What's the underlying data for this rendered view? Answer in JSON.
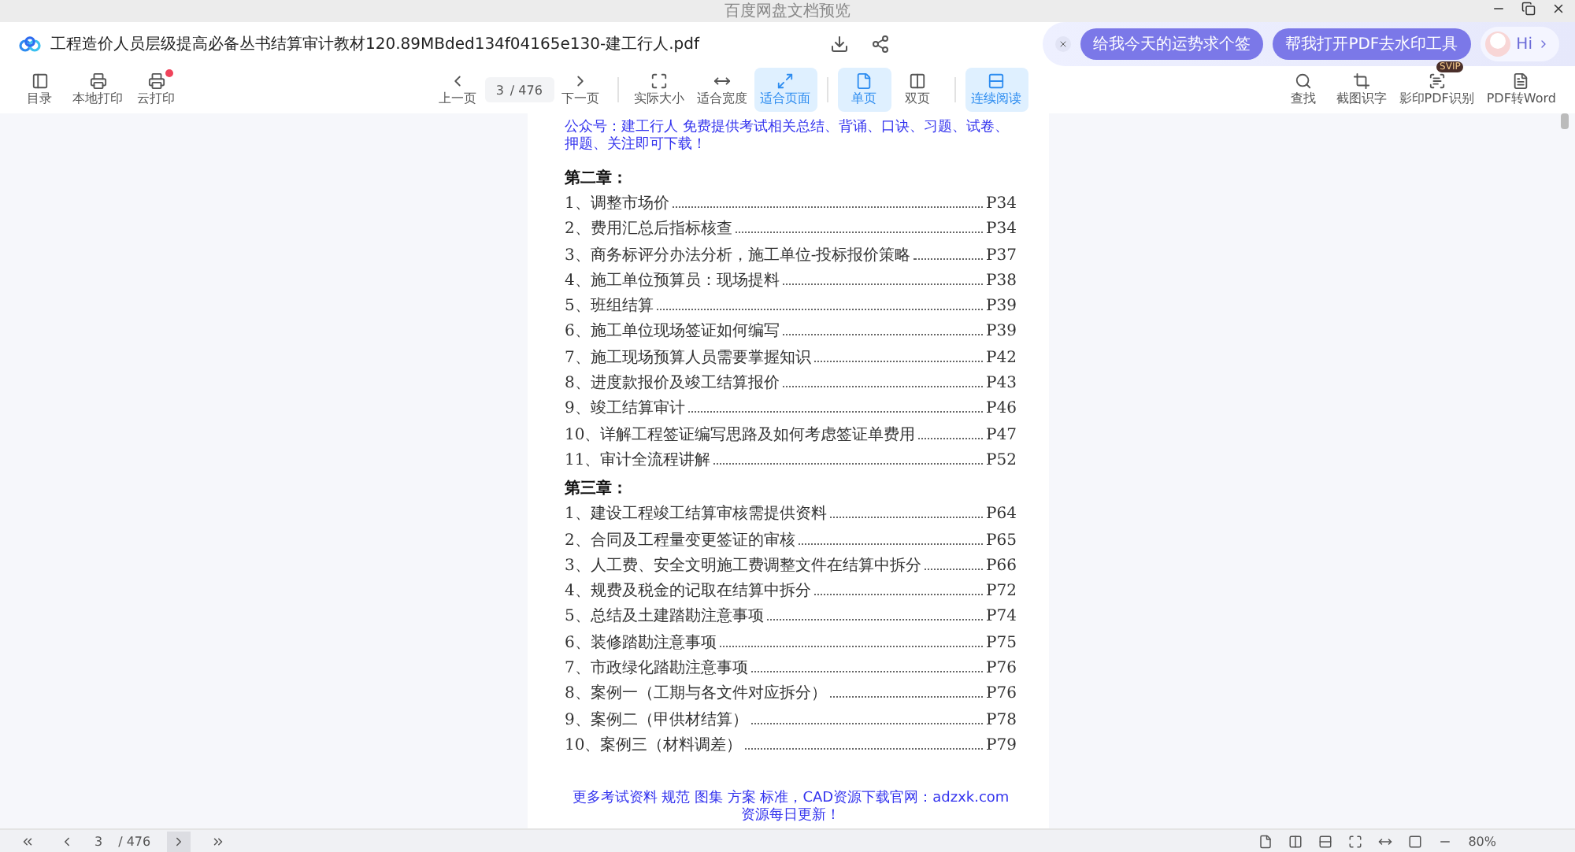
{
  "window": {
    "title": "百度网盘文档预览"
  },
  "document": {
    "title": "工程造价人员层级提高必备丛书结算审计教材120.89MBded134f04165e130-建工行人.pdf"
  },
  "assistant": {
    "suggestions": [
      "给我今天的运势求个签",
      "帮我打开PDF去水印工具"
    ],
    "greeting": "Hi"
  },
  "toolbar": {
    "left": [
      {
        "label": "目录",
        "notification": false
      },
      {
        "label": "本地打印",
        "notification": false
      },
      {
        "label": "云打印",
        "notification": true
      }
    ],
    "prev": "上一页",
    "page": "3",
    "total": "/ 476",
    "next": "下一页",
    "views": [
      {
        "label": "实际大小",
        "selected": false
      },
      {
        "label": "适合宽度",
        "selected": false
      },
      {
        "label": "适合页面",
        "selected": true
      }
    ],
    "layouts": [
      {
        "label": "单页",
        "selected": true
      },
      {
        "label": "双页",
        "selected": false
      }
    ],
    "reading": [
      {
        "label": "连续阅读",
        "selected": true
      }
    ],
    "right": [
      {
        "label": "查找"
      },
      {
        "label": "截图识字"
      },
      {
        "label": "影印PDF识别",
        "badge": "SVIP"
      },
      {
        "label": "PDF转Word"
      }
    ]
  },
  "page": {
    "header": "公众号：建工行人 免费提供考试相关总结、背诵、口诀、习题、试卷、押题、关注即可下载！",
    "sections": [
      {
        "heading": "第二章：",
        "entries": [
          {
            "text": "1、调整市场价",
            "page": "P34"
          },
          {
            "text": "2、费用汇总后指标核查",
            "page": "P34"
          },
          {
            "text": "3、商务标评分办法分析，施工单位-投标报价策略",
            "page": "P37"
          },
          {
            "text": "4、施工单位预算员：现场提料",
            "page": "P38"
          },
          {
            "text": "5、班组结算",
            "page": "P39"
          },
          {
            "text": "6、施工单位现场签证如何编写",
            "page": "P39"
          },
          {
            "text": "7、施工现场预算人员需要掌握知识",
            "page": "P42"
          },
          {
            "text": "8、进度款报价及竣工结算报价",
            "page": "P43"
          },
          {
            "text": "9、竣工结算审计",
            "page": "P46"
          },
          {
            "text": "10、详解工程签证编写思路及如何考虑签证单费用",
            "page": "P47"
          },
          {
            "text": "11、审计全流程讲解",
            "page": "P52"
          }
        ]
      },
      {
        "heading": "第三章：",
        "entries": [
          {
            "text": "1、建设工程竣工结算审核需提供资料",
            "page": "P64"
          },
          {
            "text": "2、合同及工程量变更签证的审核",
            "page": "P65"
          },
          {
            "text": "3、人工费、安全文明施工费调整文件在结算中拆分",
            "page": "P66"
          },
          {
            "text": "4、规费及税金的记取在结算中拆分",
            "page": "P72"
          },
          {
            "text": "5、总结及土建踏勘注意事项",
            "page": "P74"
          },
          {
            "text": "6、装修踏勘注意事项",
            "page": "P75"
          },
          {
            "text": "7、市政绿化踏勘注意事项",
            "page": "P76"
          },
          {
            "text": "8、案例一（工期与各文件对应拆分）",
            "page": "P76"
          },
          {
            "text": "9、案例二（甲供材结算）",
            "page": "P78"
          },
          {
            "text": "10、案例三（材料调差）",
            "page": "P79"
          }
        ]
      }
    ],
    "footer": "更多考试资料 规范 图集 方案 标准，CAD资源下载官网：adzxk.com 资源每日更新！"
  },
  "status_bar": {
    "page": "3",
    "total": "/ 476",
    "zoom": "80%"
  }
}
